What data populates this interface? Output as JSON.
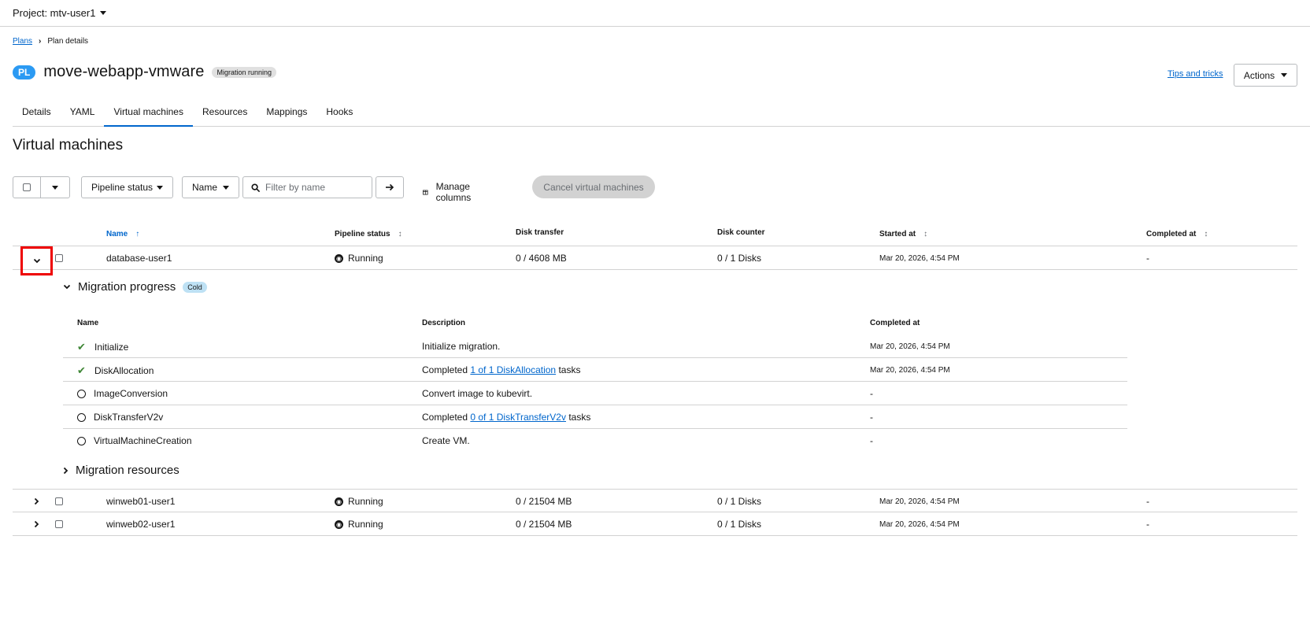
{
  "project": {
    "label": "Project: mtv-user1"
  },
  "breadcrumb": {
    "plans": "Plans",
    "current": "Plan details"
  },
  "header": {
    "badge": "PL",
    "title": "move-webapp-vmware",
    "status": "Migration running",
    "tips": "Tips and tricks",
    "actions": "Actions"
  },
  "tabs": [
    {
      "label": "Details"
    },
    {
      "label": "YAML"
    },
    {
      "label": "Virtual machines",
      "active": true
    },
    {
      "label": "Resources"
    },
    {
      "label": "Mappings"
    },
    {
      "label": "Hooks"
    }
  ],
  "section": {
    "title": "Virtual machines"
  },
  "toolbar": {
    "pipeline_filter": "Pipeline status",
    "name_filter": "Name",
    "search_placeholder": "Filter by name",
    "manage_columns": "Manage columns",
    "cancel": "Cancel virtual machines"
  },
  "table": {
    "headers": {
      "name": "Name",
      "pipeline": "Pipeline status",
      "disk_transfer": "Disk transfer",
      "disk_counter": "Disk counter",
      "started": "Started at",
      "completed": "Completed at"
    },
    "rows": [
      {
        "name": "database-user1",
        "status": "Running",
        "disk_transfer": "0 / 4608 MB",
        "disk_counter": "0 / 1 Disks",
        "started": "Mar 20, 2026, 4:54 PM",
        "completed": "-"
      },
      {
        "name": "winweb01-user1",
        "status": "Running",
        "disk_transfer": "0 / 21504 MB",
        "disk_counter": "0 / 1 Disks",
        "started": "Mar 20, 2026, 4:54 PM",
        "completed": "-"
      },
      {
        "name": "winweb02-user1",
        "status": "Running",
        "disk_transfer": "0 / 21504 MB",
        "disk_counter": "0 / 1 Disks",
        "started": "Mar 20, 2026, 4:54 PM",
        "completed": "-"
      }
    ]
  },
  "progress": {
    "title": "Migration progress",
    "badge": "Cold",
    "headers": {
      "name": "Name",
      "description": "Description",
      "completed": "Completed at"
    },
    "steps": [
      {
        "name": "Initialize",
        "desc_pre": "Initialize migration.",
        "link": "",
        "desc_post": "",
        "completed": "Mar 20, 2026, 4:54 PM"
      },
      {
        "name": "DiskAllocation",
        "desc_pre": "Completed ",
        "link": "1 of 1 DiskAllocation",
        "desc_post": " tasks",
        "completed": "Mar 20, 2026, 4:54 PM"
      },
      {
        "name": "ImageConversion",
        "desc_pre": "Convert image to kubevirt.",
        "link": "",
        "desc_post": "",
        "completed": "-"
      },
      {
        "name": "DiskTransferV2v",
        "desc_pre": "Completed ",
        "link": "0 of 1 DiskTransferV2v",
        "desc_post": " tasks",
        "completed": "-"
      },
      {
        "name": "VirtualMachineCreation",
        "desc_pre": "Create VM.",
        "link": "",
        "desc_post": "",
        "completed": "-"
      }
    ]
  },
  "resources": {
    "title": "Migration resources"
  }
}
